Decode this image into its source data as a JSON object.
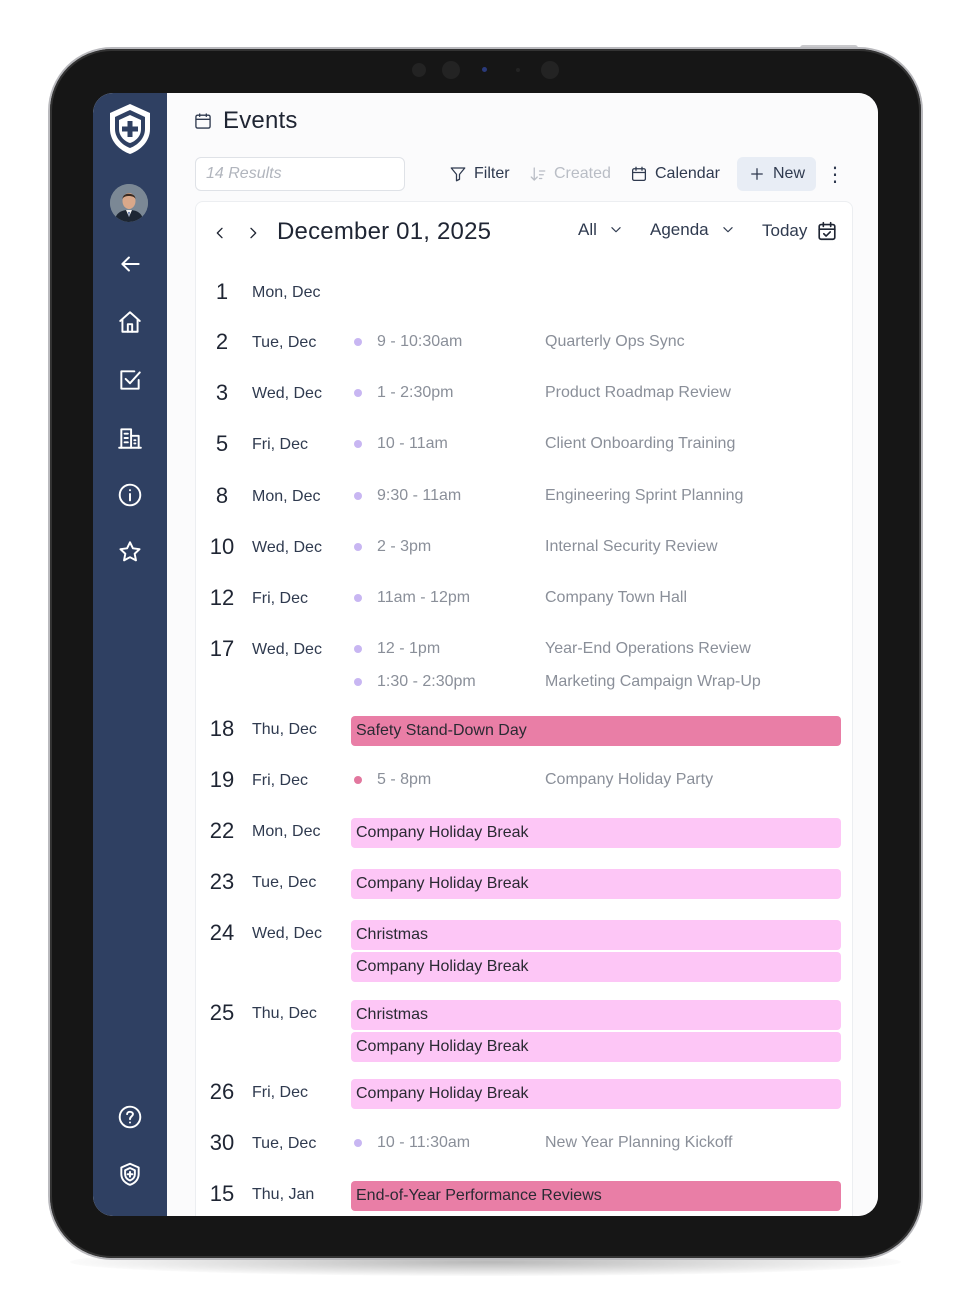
{
  "app": {
    "page_title": "Events"
  },
  "toolbar": {
    "search_placeholder": "14 Results",
    "filter_label": "Filter",
    "created_label": "Created",
    "calendar_label": "Calendar",
    "new_label": "New",
    "more_glyph": "⋮"
  },
  "calendar": {
    "current_date": "December 01, 2025",
    "filter_value": "All",
    "view_value": "Agenda",
    "today_label": "Today"
  },
  "colors": {
    "sidebar": "#2f4062",
    "dot_meeting": "#c8b6f2",
    "dot_party": "#e2779e",
    "bar_strong": "#e97ea6",
    "bar_light": "#fdc6f6"
  },
  "icons": [
    "shield-logo-icon",
    "back-arrow-icon",
    "home-icon",
    "checklist-icon",
    "buildings-icon",
    "info-icon",
    "star-icon",
    "help-icon",
    "shield-badge-icon",
    "calendar-icon",
    "filter-icon",
    "sort-icon",
    "plus-icon",
    "chevron-left-icon",
    "chevron-right-icon",
    "chevron-down-icon",
    "calendar-check-icon"
  ],
  "agenda": [
    {
      "num": "1",
      "label": "Mon, Dec",
      "items": []
    },
    {
      "num": "2",
      "label": "Tue, Dec",
      "items": [
        {
          "kind": "timed",
          "dot": "meeting",
          "time": "9 - 10:30am",
          "name": "Quarterly Ops Sync"
        }
      ]
    },
    {
      "num": "3",
      "label": "Wed, Dec",
      "items": [
        {
          "kind": "timed",
          "dot": "meeting",
          "time": "1 - 2:30pm",
          "name": "Product Roadmap Review"
        }
      ]
    },
    {
      "num": "5",
      "label": "Fri, Dec",
      "items": [
        {
          "kind": "timed",
          "dot": "meeting",
          "time": "10 - 11am",
          "name": "Client Onboarding Training"
        }
      ]
    },
    {
      "num": "8",
      "label": "Mon, Dec",
      "items": [
        {
          "kind": "timed",
          "dot": "meeting",
          "time": "9:30 - 11am",
          "name": "Engineering Sprint Planning"
        }
      ]
    },
    {
      "num": "10",
      "label": "Wed, Dec",
      "items": [
        {
          "kind": "timed",
          "dot": "meeting",
          "time": "2 - 3pm",
          "name": "Internal Security Review"
        }
      ]
    },
    {
      "num": "12",
      "label": "Fri, Dec",
      "items": [
        {
          "kind": "timed",
          "dot": "meeting",
          "time": "11am - 12pm",
          "name": "Company Town Hall"
        }
      ]
    },
    {
      "num": "17",
      "label": "Wed, Dec",
      "items": [
        {
          "kind": "timed",
          "dot": "meeting",
          "time": "12 - 1pm",
          "name": "Year-End Operations Review"
        },
        {
          "kind": "timed",
          "dot": "meeting",
          "time": "1:30 - 2:30pm",
          "name": "Marketing Campaign Wrap-Up"
        }
      ]
    },
    {
      "num": "18",
      "label": "Thu, Dec",
      "items": [
        {
          "kind": "allday",
          "style": "strong",
          "name": "Safety Stand-Down Day"
        }
      ]
    },
    {
      "num": "19",
      "label": "Fri, Dec",
      "items": [
        {
          "kind": "timed",
          "dot": "party",
          "time": "5 - 8pm",
          "name": "Company Holiday Party"
        }
      ]
    },
    {
      "num": "22",
      "label": "Mon, Dec",
      "items": [
        {
          "kind": "allday",
          "style": "light",
          "name": "Company Holiday Break"
        }
      ]
    },
    {
      "num": "23",
      "label": "Tue, Dec",
      "items": [
        {
          "kind": "allday",
          "style": "light",
          "name": "Company Holiday Break"
        }
      ]
    },
    {
      "num": "24",
      "label": "Wed, Dec",
      "items": [
        {
          "kind": "allday",
          "style": "light",
          "name": "Christmas"
        },
        {
          "kind": "allday",
          "style": "light",
          "name": "Company Holiday Break"
        }
      ]
    },
    {
      "num": "25",
      "label": "Thu, Dec",
      "items": [
        {
          "kind": "allday",
          "style": "light",
          "name": "Christmas"
        },
        {
          "kind": "allday",
          "style": "light",
          "name": "Company Holiday Break"
        }
      ]
    },
    {
      "num": "26",
      "label": "Fri, Dec",
      "items": [
        {
          "kind": "allday",
          "style": "light",
          "name": "Company Holiday Break"
        }
      ]
    },
    {
      "num": "30",
      "label": "Tue, Dec",
      "items": [
        {
          "kind": "timed",
          "dot": "meeting",
          "time": "10 - 11:30am",
          "name": "New Year Planning Kickoff"
        }
      ]
    },
    {
      "num": "15",
      "label": "Thu, Jan",
      "items": [
        {
          "kind": "allday",
          "style": "strong",
          "name": "End-of-Year Performance Reviews"
        }
      ]
    }
  ]
}
